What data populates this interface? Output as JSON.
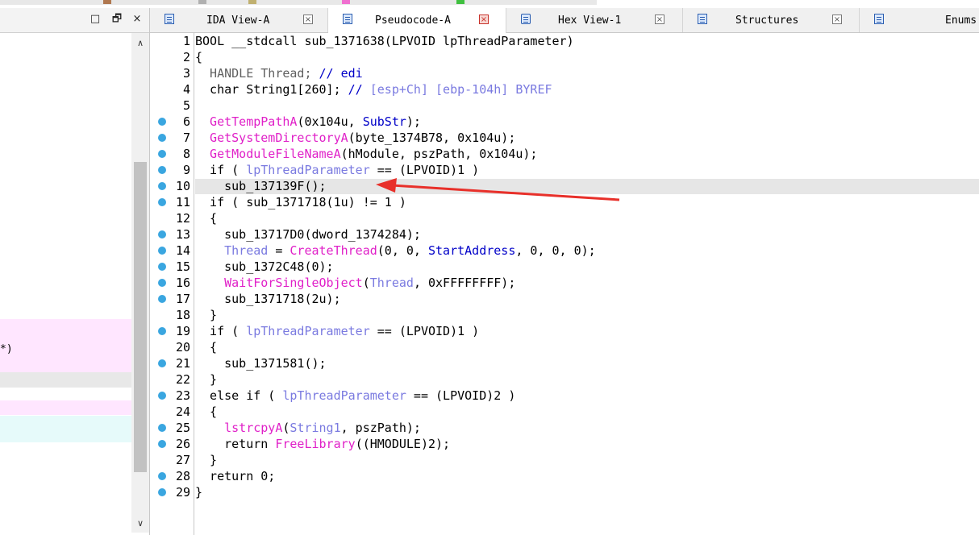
{
  "tabs": [
    {
      "label": "IDA View-A",
      "icon": "ida-view-icon",
      "active": false
    },
    {
      "label": "Pseudocode-A",
      "icon": "pseudocode-icon",
      "active": true
    },
    {
      "label": "Hex View-1",
      "icon": "hex-view-icon",
      "active": false
    },
    {
      "label": "Structures",
      "icon": "structures-icon",
      "active": false
    },
    {
      "label": "Enums",
      "icon": "enums-icon",
      "active": false
    }
  ],
  "left_pane": {
    "buttons": [
      "□",
      "🗗",
      "×"
    ],
    "rows": [
      {
        "text": "*)",
        "color": "#ffe6ff"
      },
      {
        "text": "",
        "color": "#e8e8e8"
      },
      {
        "text": "",
        "color": "#ffe6ff"
      },
      {
        "text": "",
        "color": "#e6fafa"
      }
    ],
    "scroll_up": "∧",
    "scroll_down": "∨"
  },
  "colors": {
    "accent_function": "#e020c8",
    "accent_variable": "#7a7ae0",
    "breakpoint": "#3aa6e0",
    "highlight_line": "#e6e6e6",
    "arrow": "#e8302a"
  },
  "code": {
    "highlighted_line": 10,
    "breakpoint_lines": [
      6,
      7,
      8,
      9,
      10,
      11,
      13,
      14,
      15,
      16,
      17,
      19,
      21,
      23,
      25,
      26,
      28,
      29
    ],
    "lines": [
      {
        "n": "1",
        "segs": [
          [
            "kw",
            "BOOL __stdcall sub_1371638(LPVOID lpThreadParameter)"
          ]
        ]
      },
      {
        "n": "2",
        "segs": [
          [
            "kw",
            "{"
          ]
        ]
      },
      {
        "n": "3",
        "segs": [
          [
            "gr",
            "  HANDLE Thread; "
          ],
          [
            "bl",
            "// edi"
          ]
        ]
      },
      {
        "n": "4",
        "segs": [
          [
            "kw",
            "  char String1[260]; "
          ],
          [
            "bl",
            "// "
          ],
          [
            "cm",
            "[esp+Ch] [ebp-104h] BYREF"
          ]
        ]
      },
      {
        "n": "5",
        "segs": [
          [
            "kw",
            ""
          ]
        ]
      },
      {
        "n": "6",
        "segs": [
          [
            "fn",
            "  GetTempPathA"
          ],
          [
            "kw",
            "(0x104u, "
          ],
          [
            "bl",
            "SubStr"
          ],
          [
            "kw",
            ");"
          ]
        ]
      },
      {
        "n": "7",
        "segs": [
          [
            "fn",
            "  GetSystemDirectoryA"
          ],
          [
            "kw",
            "(byte_1374B78, 0x104u);"
          ]
        ]
      },
      {
        "n": "8",
        "segs": [
          [
            "fn",
            "  GetModuleFileNameA"
          ],
          [
            "kw",
            "(hModule, pszPath, 0x104u);"
          ]
        ]
      },
      {
        "n": "9",
        "segs": [
          [
            "kw",
            "  if ( "
          ],
          [
            "cm",
            "lpThreadParameter"
          ],
          [
            "kw",
            " == (LPVOID)1 )"
          ]
        ]
      },
      {
        "n": "10",
        "segs": [
          [
            "kw",
            "    sub_137139F();"
          ]
        ]
      },
      {
        "n": "11",
        "segs": [
          [
            "kw",
            "  if ( sub_1371718(1u) != 1 )"
          ]
        ]
      },
      {
        "n": "12",
        "segs": [
          [
            "kw",
            "  {"
          ]
        ]
      },
      {
        "n": "13",
        "segs": [
          [
            "kw",
            "    sub_13717D0(dword_1374284);"
          ]
        ]
      },
      {
        "n": "14",
        "segs": [
          [
            "cm",
            "    Thread"
          ],
          [
            "kw",
            " = "
          ],
          [
            "fn",
            "CreateThread"
          ],
          [
            "kw",
            "(0, 0, "
          ],
          [
            "bl",
            "StartAddress"
          ],
          [
            "kw",
            ", 0, 0, 0);"
          ]
        ]
      },
      {
        "n": "15",
        "segs": [
          [
            "kw",
            "    sub_1372C48(0);"
          ]
        ]
      },
      {
        "n": "16",
        "segs": [
          [
            "fn",
            "    WaitForSingleObject"
          ],
          [
            "kw",
            "("
          ],
          [
            "cm",
            "Thread"
          ],
          [
            "kw",
            ", 0xFFFFFFFF);"
          ]
        ]
      },
      {
        "n": "17",
        "segs": [
          [
            "kw",
            "    sub_1371718(2u);"
          ]
        ]
      },
      {
        "n": "18",
        "segs": [
          [
            "kw",
            "  }"
          ]
        ]
      },
      {
        "n": "19",
        "segs": [
          [
            "kw",
            "  if ( "
          ],
          [
            "cm",
            "lpThreadParameter"
          ],
          [
            "kw",
            " == (LPVOID)1 )"
          ]
        ]
      },
      {
        "n": "20",
        "segs": [
          [
            "kw",
            "  {"
          ]
        ]
      },
      {
        "n": "21",
        "segs": [
          [
            "kw",
            "    sub_1371581();"
          ]
        ]
      },
      {
        "n": "22",
        "segs": [
          [
            "kw",
            "  }"
          ]
        ]
      },
      {
        "n": "23",
        "segs": [
          [
            "kw",
            "  else if ( "
          ],
          [
            "cm",
            "lpThreadParameter"
          ],
          [
            "kw",
            " == (LPVOID)2 )"
          ]
        ]
      },
      {
        "n": "24",
        "segs": [
          [
            "kw",
            "  {"
          ]
        ]
      },
      {
        "n": "25",
        "segs": [
          [
            "fn",
            "    lstrcpyA"
          ],
          [
            "kw",
            "("
          ],
          [
            "cm",
            "String1"
          ],
          [
            "kw",
            ", pszPath);"
          ]
        ]
      },
      {
        "n": "26",
        "segs": [
          [
            "kw",
            "    return "
          ],
          [
            "fn",
            "FreeLibrary"
          ],
          [
            "kw",
            "((HMODULE)2);"
          ]
        ]
      },
      {
        "n": "27",
        "segs": [
          [
            "kw",
            "  }"
          ]
        ]
      },
      {
        "n": "28",
        "segs": [
          [
            "kw",
            "  return 0;"
          ]
        ]
      },
      {
        "n": "29",
        "segs": [
          [
            "kw",
            "}"
          ]
        ]
      }
    ]
  }
}
